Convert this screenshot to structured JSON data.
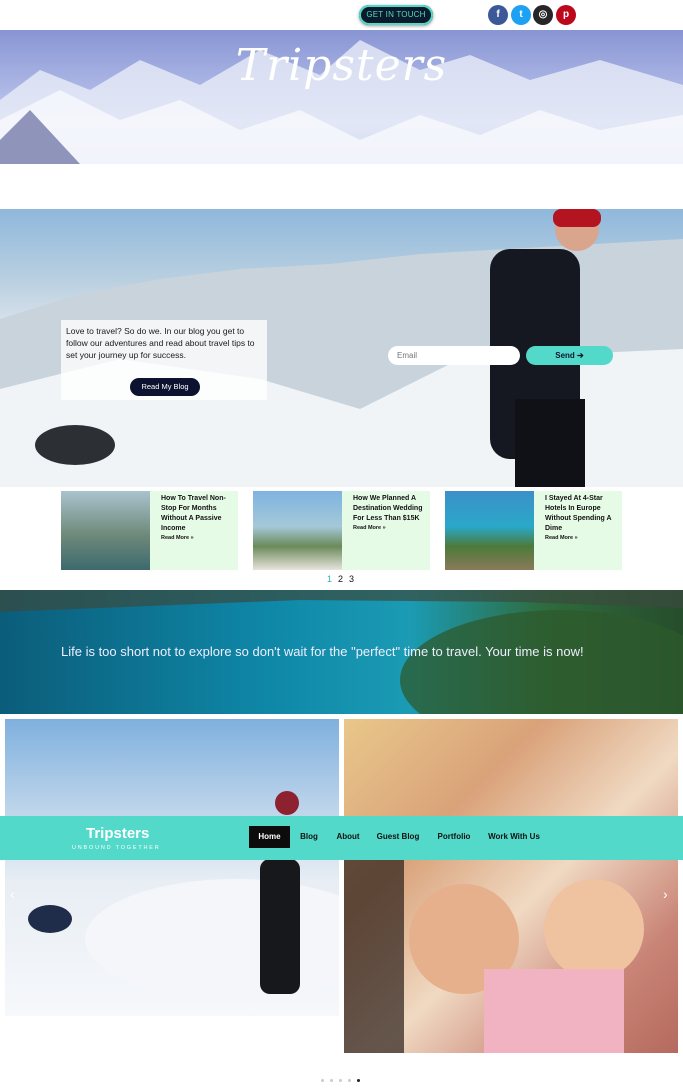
{
  "header": {
    "get_in_touch": "GET IN TOUCH",
    "social": [
      {
        "icon": "facebook-icon",
        "glyph": "f",
        "color": "#3b5998"
      },
      {
        "icon": "twitter-icon",
        "glyph": "t",
        "color": "#1da1f2"
      },
      {
        "icon": "instagram-icon",
        "glyph": "◎",
        "color": "#262626"
      },
      {
        "icon": "pinterest-icon",
        "glyph": "p",
        "color": "#bd081c"
      }
    ]
  },
  "hero": {
    "title": "Tripsters"
  },
  "intro": {
    "text": "Love to travel? So do we. In our blog you get to follow our adventures and read about travel tips to set your journey up for success.",
    "read_blog": "Read My Blog",
    "email_placeholder": "Email",
    "send_label": "Send"
  },
  "posts": [
    {
      "title": "How To Travel Non-Stop For Months Without A Passive Income",
      "more": "Read More »"
    },
    {
      "title": "How We Planned A Destination Wedding For Less Than $15K",
      "more": "Read More »"
    },
    {
      "title": "I Stayed At 4-Star Hotels In Europe Without Spending A Dime",
      "more": "Read More »"
    }
  ],
  "pagination": [
    "1",
    "2",
    "3"
  ],
  "banner": {
    "quote": "Life is too short not to explore so don't wait for the \"perfect\" time to travel. Your time is now!"
  },
  "nav": {
    "brand": "Tripsters",
    "tagline": "UNBOUND TOGETHER",
    "items": [
      "Home",
      "Blog",
      "About",
      "Guest Blog",
      "Portfolio",
      "Work With Us"
    ],
    "active": "Home"
  },
  "colors": {
    "accent": "#53d9c9",
    "dark": "#0c1230",
    "card_bg": "#e6fbe6"
  }
}
